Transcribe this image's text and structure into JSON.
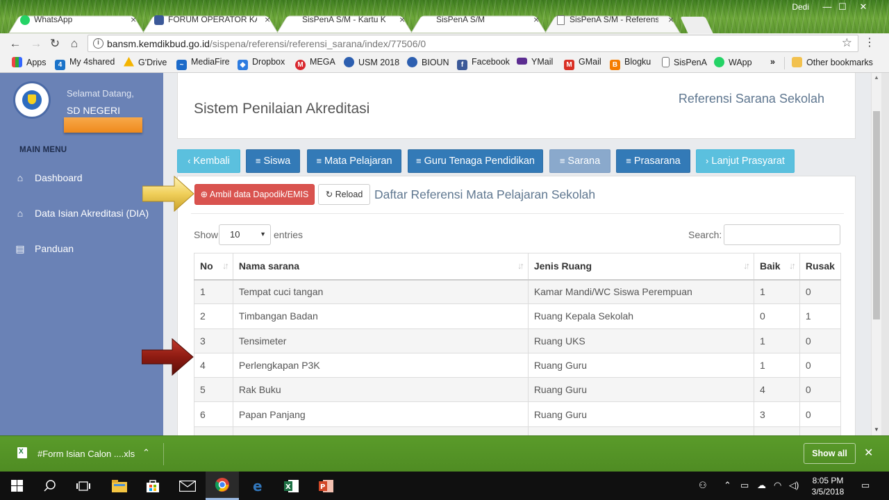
{
  "window": {
    "user": "Dedi",
    "controls": {
      "minimize": "—",
      "maximize": "☐",
      "close": "✕"
    }
  },
  "tabs": [
    {
      "label": "WhatsApp",
      "favicon": "whatsapp-icon",
      "color": "#25d366"
    },
    {
      "label": "FORUM OPERATOR KAB",
      "favicon": "facebook-icon",
      "color": "#3b5998"
    },
    {
      "label": "SisPenA S/M - Kartu Kend",
      "favicon": "none",
      "color": ""
    },
    {
      "label": "SisPenA S/M",
      "favicon": "none",
      "color": ""
    },
    {
      "label": "SisPenA S/M - Referensi",
      "favicon": "page-icon",
      "color": ""
    }
  ],
  "address": {
    "host": "bansm.kemdikbud.go.id",
    "path": "/sispena/referensi/referensi_sarana/index/77506/0"
  },
  "bookmarks": [
    {
      "label": "Apps",
      "icon": "apps-grid-icon",
      "color": "#e44"
    },
    {
      "label": "My 4shared",
      "icon": "4shared-icon",
      "color": "#1a73c9"
    },
    {
      "label": "G'Drive",
      "icon": "gdrive-icon",
      "color": "#f4b400"
    },
    {
      "label": "MediaFire",
      "icon": "mediafire-icon",
      "color": "#1b6ac9"
    },
    {
      "label": "Dropbox",
      "icon": "dropbox-icon",
      "color": "#2d7ce0"
    },
    {
      "label": "MEGA",
      "icon": "mega-icon",
      "color": "#d9272e"
    },
    {
      "label": "USM 2018",
      "icon": "tutwuri-icon",
      "color": "#2d5fb0"
    },
    {
      "label": "BIOUN",
      "icon": "tutwuri-icon",
      "color": "#2d5fb0"
    },
    {
      "label": "Facebook",
      "icon": "facebook-icon",
      "color": "#3b5998"
    },
    {
      "label": "YMail",
      "icon": "ymail-icon",
      "color": "#5c2d91"
    },
    {
      "label": "GMail",
      "icon": "gmail-icon",
      "color": "#d93025"
    },
    {
      "label": "Blogku",
      "icon": "blogger-icon",
      "color": "#f57d00"
    },
    {
      "label": "SisPenA",
      "icon": "page-icon",
      "color": "#777"
    },
    {
      "label": "WApp",
      "icon": "whatsapp-icon",
      "color": "#25d366"
    }
  ],
  "bookmarks_more": "»",
  "other_bookmarks": "Other bookmarks",
  "sidebar": {
    "welcome": "Selamat Datang,",
    "school": "SD NEGERI",
    "main_menu": "MAIN MENU",
    "items": [
      {
        "label": "Dashboard",
        "icon": "home-icon"
      },
      {
        "label": "Data Isian Akreditasi (DIA)",
        "icon": "home-icon"
      },
      {
        "label": "Panduan",
        "icon": "book-icon"
      }
    ]
  },
  "header": {
    "app_title": "Sistem Penilaian Akreditasi",
    "page_title": "Referensi Sarana Sekolah"
  },
  "nav_buttons": [
    {
      "label": "Kembali",
      "icon": "‹",
      "style": "info"
    },
    {
      "label": "Siswa",
      "icon": "≡",
      "style": "primary"
    },
    {
      "label": "Mata Pelajaran",
      "icon": "≡",
      "style": "primary"
    },
    {
      "label": "Guru Tenaga Pendidikan",
      "icon": "≡",
      "style": "primary"
    },
    {
      "label": "Sarana",
      "icon": "≡",
      "style": "muted"
    },
    {
      "label": "Prasarana",
      "icon": "≡",
      "style": "primary"
    },
    {
      "label": "Lanjut Prasyarat",
      "icon": "›",
      "style": "info"
    }
  ],
  "panel": {
    "fetch_button": "Ambil data Dapodik/EMIS",
    "reload_button": "Reload",
    "title": "Daftar Referensi Mata Pelajaran Sekolah",
    "show_label": "Show",
    "page_length": "10",
    "entries_label": "entries",
    "search_label": "Search:",
    "search_value": ""
  },
  "table": {
    "columns": [
      "No",
      "Nama sarana",
      "Jenis Ruang",
      "Baik",
      "Rusak"
    ],
    "rows": [
      [
        "1",
        "Tempat cuci tangan",
        "Kamar Mandi/WC Siswa Perempuan",
        "1",
        "0"
      ],
      [
        "2",
        "Timbangan Badan",
        "Ruang Kepala Sekolah",
        "0",
        "1"
      ],
      [
        "3",
        "Tensimeter",
        "Ruang UKS",
        "1",
        "0"
      ],
      [
        "4",
        "Perlengkapan P3K",
        "Ruang Guru",
        "1",
        "0"
      ],
      [
        "5",
        "Rak Buku",
        "Ruang Guru",
        "4",
        "0"
      ],
      [
        "6",
        "Papan Panjang",
        "Ruang Guru",
        "3",
        "0"
      ]
    ]
  },
  "download": {
    "file": "#Form Isian Calon ....xls",
    "show_all": "Show all"
  },
  "taskbar": {
    "time": "8:05 PM",
    "date": "3/5/2018"
  },
  "colors": {
    "sidebar": "#6a82b6",
    "primary": "#337ab7",
    "info": "#5bc0de",
    "danger": "#d9534f",
    "chrome_green": "#5a9b2a"
  }
}
